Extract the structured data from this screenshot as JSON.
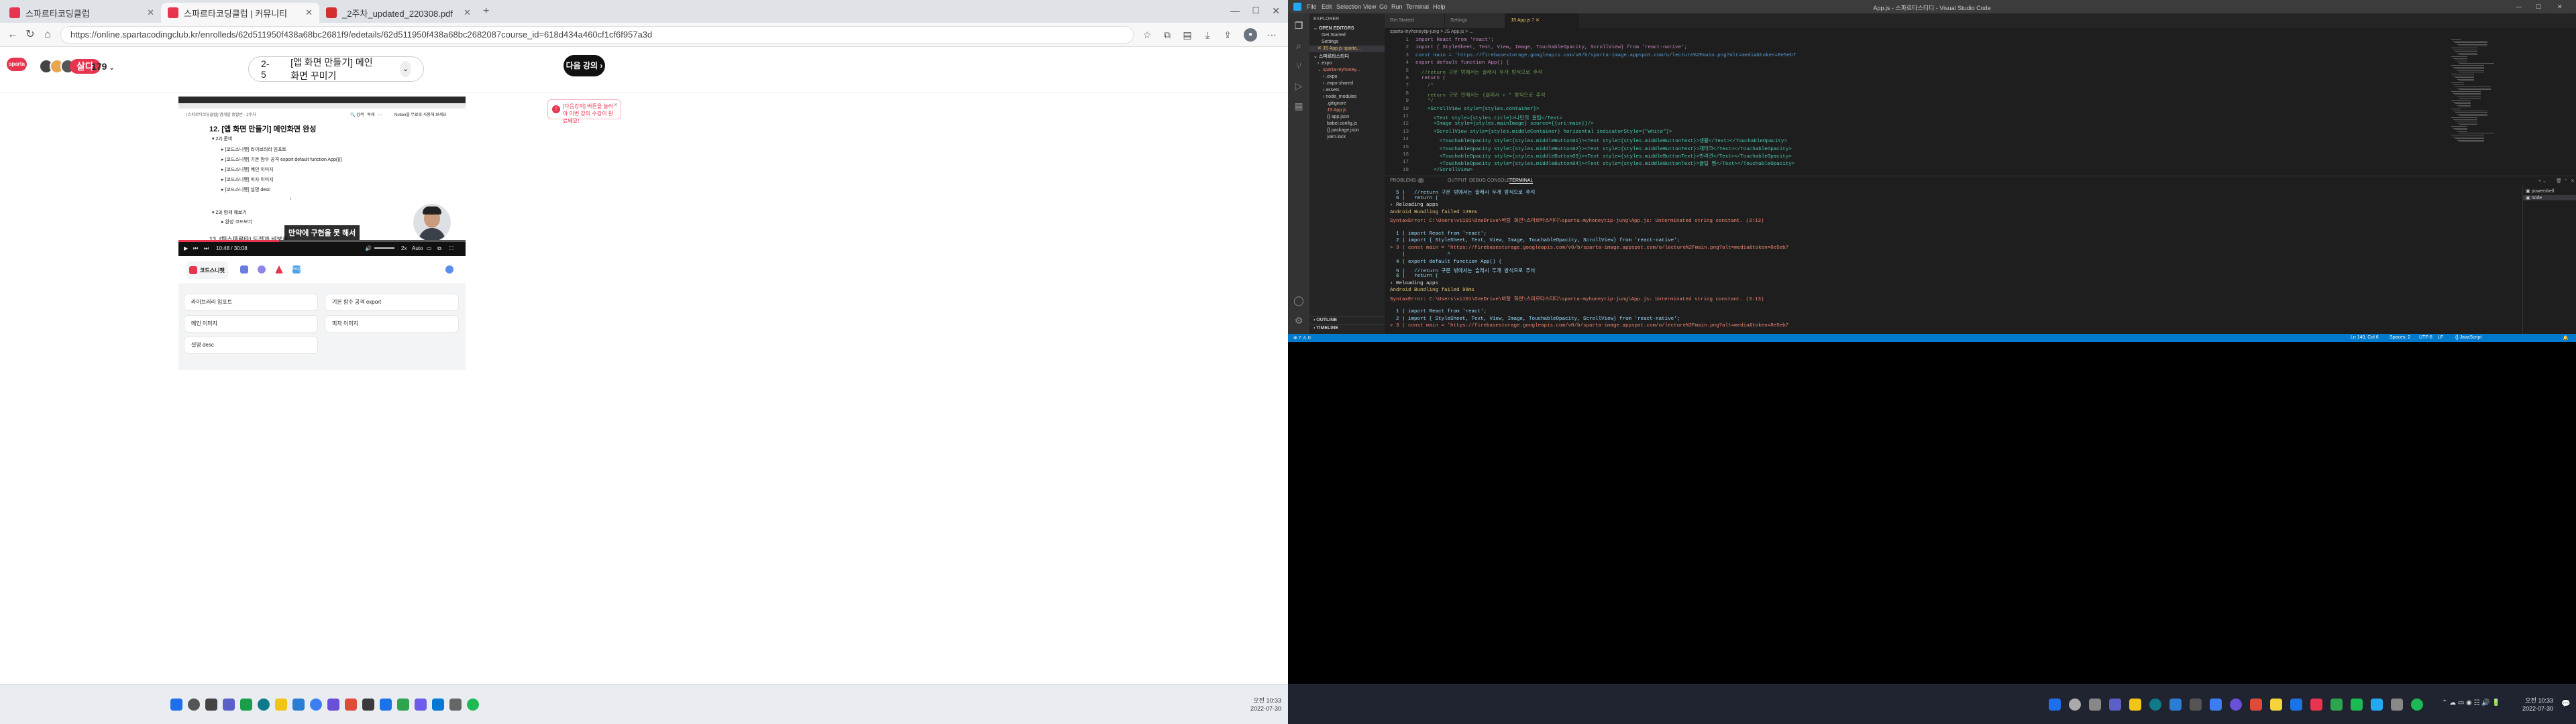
{
  "browser": {
    "tabs": [
      {
        "label": "스파르타코딩클럽",
        "color": "#e8344e"
      },
      {
        "label": "스파르타코딩클럽 | 커뮤니티",
        "color": "#e8344e"
      },
      {
        "label": "_2주차_updated_220308.pdf",
        "color": "#d32f2f"
      }
    ],
    "url": "https://online.spartacodingclub.kr/enrolleds/62d511950f438a68bc2681f9/edetails/62d511950f438a68bc2682087course_id=618d434a460cf1cf6f957a3d"
  },
  "site": {
    "streak_label": "살다",
    "streak_count": "179",
    "lesson_number": "2-5",
    "lesson_title": "[앱 화면 만들기] 메인화면 꾸미기",
    "next_button": "다음 강의",
    "toast": "[다음강의] 버튼을 눌러야 이번 강의 수강이 완료돼요!"
  },
  "video": {
    "course_header": "[스파르타코딩클럽] 앱개발 종합반 - 2주차",
    "toolbar": [
      "검색",
      "복제"
    ],
    "notion_cta": "Notion을 무료로 사용해 보세요",
    "note_title": "12. [앱 화면 만들기] 메인화면 완성",
    "section1": "22) 준비",
    "items": [
      "[코드스니펫] 라이브러리 임포트",
      "[코드스니펫] 기본 함수 공격 export default function App(){}",
      "[코드스니펫] 메인 이미지",
      "[코드스니펫] 피자 이미지",
      "[코드스니펫] 설명 desc"
    ],
    "page_num": "1",
    "section2": "23) 함께 해보기",
    "sub_item": "완성 코드보기",
    "next_section": "13. [팀스파르타] 도전과 비보호",
    "subtitle": "만약에 구현을 못 해서",
    "time": "10:48 / 30:08",
    "speed": "2x",
    "quality": "Auto",
    "progress": 0.35
  },
  "snippets": {
    "active_tab": "코드스니펫",
    "faq_label": "FAQ",
    "cards": [
      "라이브러리 임포트",
      "기본 함수 공격 export",
      "메인 이미지",
      "피자 이미지",
      "설명 desc"
    ]
  },
  "taskbar_left": {
    "time": "오전 10:33",
    "date": "2022-07-30"
  },
  "vscode": {
    "title": "App.js - 스파르타스티디 - Visual Studio Code",
    "menu": [
      "File",
      "Edit",
      "Selection",
      "View",
      "Go",
      "Run",
      "Terminal",
      "Help"
    ],
    "tabs": [
      {
        "label": "Get Started"
      },
      {
        "label": "Settings"
      },
      {
        "label": "JS App.js",
        "badge": "7"
      }
    ],
    "breadcrumb": "sparta-myhoneytip-jung > JS App.js > ...",
    "explorer": {
      "title": "EXPLORER",
      "open_editors": "OPEN EDITORS",
      "open_files": [
        "Get Started",
        "Settings",
        "JS App.js sparta..."
      ],
      "root": "스파르타스티디",
      "tree": [
        ".expo",
        "sparta-myhoney...",
        ".expo",
        ".expo-shared",
        "assets",
        "node_modules",
        ".gitignore",
        "JS App.js",
        "{} app.json",
        "babel.config.js",
        "{} package.json",
        "yarn.lock"
      ],
      "outline": "OUTLINE",
      "timeline": "TIMELINE"
    },
    "line_numbers": [
      "1",
      "2",
      "3",
      "4",
      "5",
      "6",
      "7",
      "8",
      "9",
      "10",
      "11",
      "12",
      "13",
      "14",
      "15",
      "16",
      "17",
      "18"
    ],
    "code": [
      "import React from 'react';",
      "import { StyleSheet, Text, View, Image, TouchableOpacity, ScrollView} from 'react-native';",
      "const main = 'https://firebasestorage.googleapis.com/v0/b/sparta-image.appspot.com/o/lecture%2Fmain.png?alt=media&token=8e5eb7",
      "export default function App() {",
      "  //return 구문 밖에서는 슬래시 두개 방식으로 주석",
      "  return (",
      "    /*",
      "    return 구문 안에서는 {슬래시 + * 방식으로 주석",
      "    */",
      "    <ScrollView style={styles.container}>",
      "      <Text style={styles.title}>나만의 꿀팁</Text>",
      "      <Image style={styles.mainImage} source={{uri:main}}/>",
      "      <ScrollView style={styles.middleContainer} horizontal indicatorStyle={\"white\"}>",
      "        <TouchableOpacity style={styles.middleButton01}><Text style={styles.middleButtonText}>생활</Text></TouchableOpacity>",
      "        <TouchableOpacity style={styles.middleButton02}><Text style={styles.middleButtonText}>재테크</Text></TouchableOpacity>",
      "        <TouchableOpacity style={styles.middleButton03}><Text style={styles.middleButtonText}>반려견</Text></TouchableOpacity>",
      "        <TouchableOpacity style={styles.middleButton04}><Text style={styles.middleButtonText}>꿀팁 찜</Text></TouchableOpacity>",
      "      </ScrollView>"
    ],
    "panel_tabs": [
      "PROBLEMS",
      "OUTPUT",
      "DEBUG CONSOLE",
      "TERMINAL"
    ],
    "problems_count": "7",
    "terminal": [
      "  5 |   //return 구문 밖에서는 슬래시 두개 방식으로 주석",
      "  6 |   return (",
      "› Reloading apps",
      "Android Bundling failed 139ms",
      "SyntaxError: C:\\Users\\vi101\\OneDrive\\바탕 화면\\스파르타스티디\\sparta-myhoneytip-jung\\App.js: Unterminated string constant. (3:13)",
      "",
      "  1 | import React from 'react';",
      "  2 | import { StyleSheet, Text, View, Image, TouchableOpacity, ScrollView} from 'react-native';",
      "> 3 | const main = 'https://firebasestorage.googleapis.com/v0/b/sparta-image.appspot.com/o/lecture%2Fmain.png?alt=media&token=8e5eb7",
      "    |              ^",
      "  4 | export default function App() {",
      "  5 |   //return 구문 밖에서는 슬래시 두개 방식으로 주석",
      "  6 |   return (",
      "› Reloading apps",
      "Android Bundling failed 98ms",
      "SyntaxError: C:\\Users\\vi101\\OneDrive\\바탕 화면\\스파르타스티디\\sparta-myhoneytip-jung\\App.js: Unterminated string constant. (3:13)",
      "",
      "  1 | import React from 'react';",
      "  2 | import { StyleSheet, Text, View, Image, TouchableOpacity, ScrollView} from 'react-native';",
      "> 3 | const main = 'https://firebasestorage.googleapis.com/v0/b/sparta-image.appspot.com/o/lecture%2Fmain.png?alt=media&token=8e5eb7"
    ],
    "term_list": [
      "powershell",
      "node"
    ],
    "status": {
      "errors": "⊗ 7 ⚠ 0",
      "position": "Ln 140, Col 6",
      "spaces": "Spaces: 2",
      "encoding": "UTF-8",
      "eol": "LF",
      "lang": "{} JavaScript"
    }
  },
  "taskbar_right": {
    "time": "오전 10:33",
    "date": "2022-07-30"
  }
}
